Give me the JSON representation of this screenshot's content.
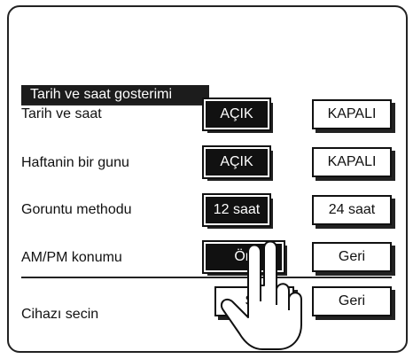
{
  "header": {
    "title": "Tarih ve saat gosterimi"
  },
  "rows": [
    {
      "label": "Tarih ve saat",
      "options": [
        "AÇIK",
        "KAPALI"
      ],
      "selected": 0
    },
    {
      "label": "Haftanin bir gunu",
      "options": [
        "AÇIK",
        "KAPALI"
      ],
      "selected": 0
    },
    {
      "label": "Goruntu methodu",
      "options": [
        "12 saat",
        "24 saat"
      ],
      "selected": 0
    },
    {
      "label": "AM/PM konumu",
      "options": [
        "Ön",
        "Geri"
      ],
      "selected": 0
    }
  ],
  "footer": {
    "label": "Cihazı secin",
    "select_button": "SE",
    "back_button": "Geri"
  },
  "icons": {
    "pointer": "hand-pointer-icon"
  }
}
